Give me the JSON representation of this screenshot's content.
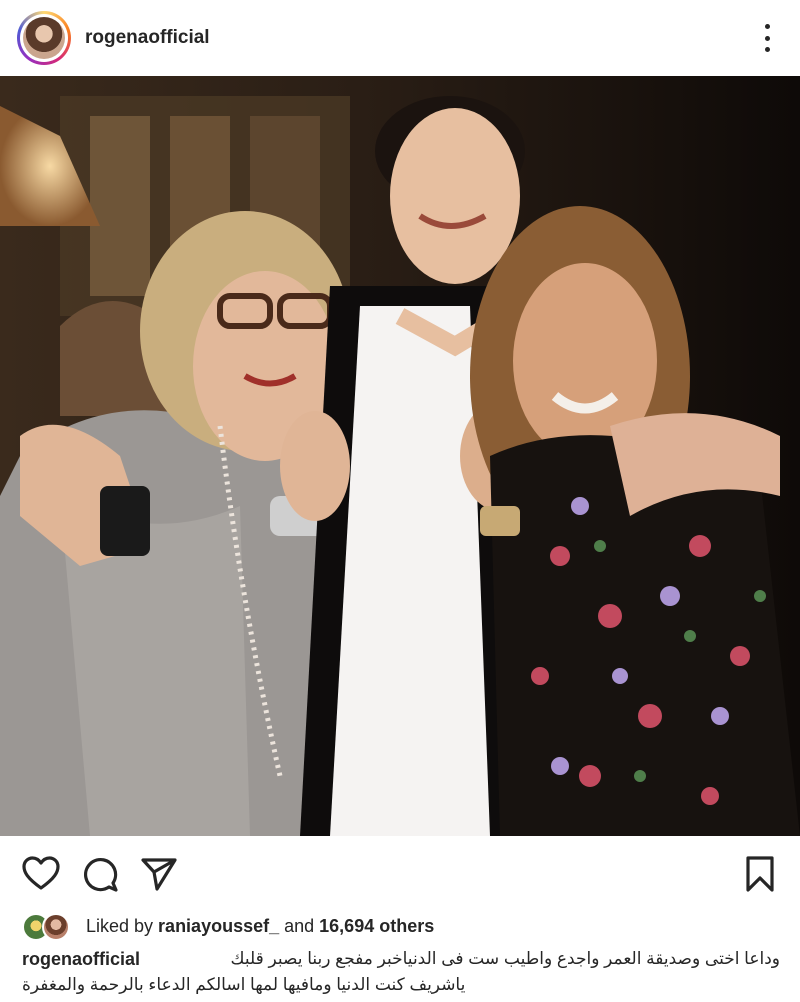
{
  "post": {
    "username": "rogenaofficial"
  },
  "icons": {
    "more": "more-options-icon",
    "like": "heart-icon",
    "comment": "comment-icon",
    "share": "send-icon",
    "save": "bookmark-icon"
  },
  "likes": {
    "prefix": "Liked by ",
    "user": "raniayoussef_",
    "middle": " and ",
    "count": "16,694 others"
  },
  "caption": {
    "username": "rogenaofficial",
    "line1": "وداعا اختى وصديقة العمر واجدع واطيب ست فى الدنياخبر مفجع  ربنا يصبر قلبك",
    "line2": "ياشريف كنت الدنيا ومافيها لمها اسالكم الدعاء بالرحمة والمغفرة"
  },
  "colors": {
    "text": "#262626",
    "background": "#ffffff"
  }
}
